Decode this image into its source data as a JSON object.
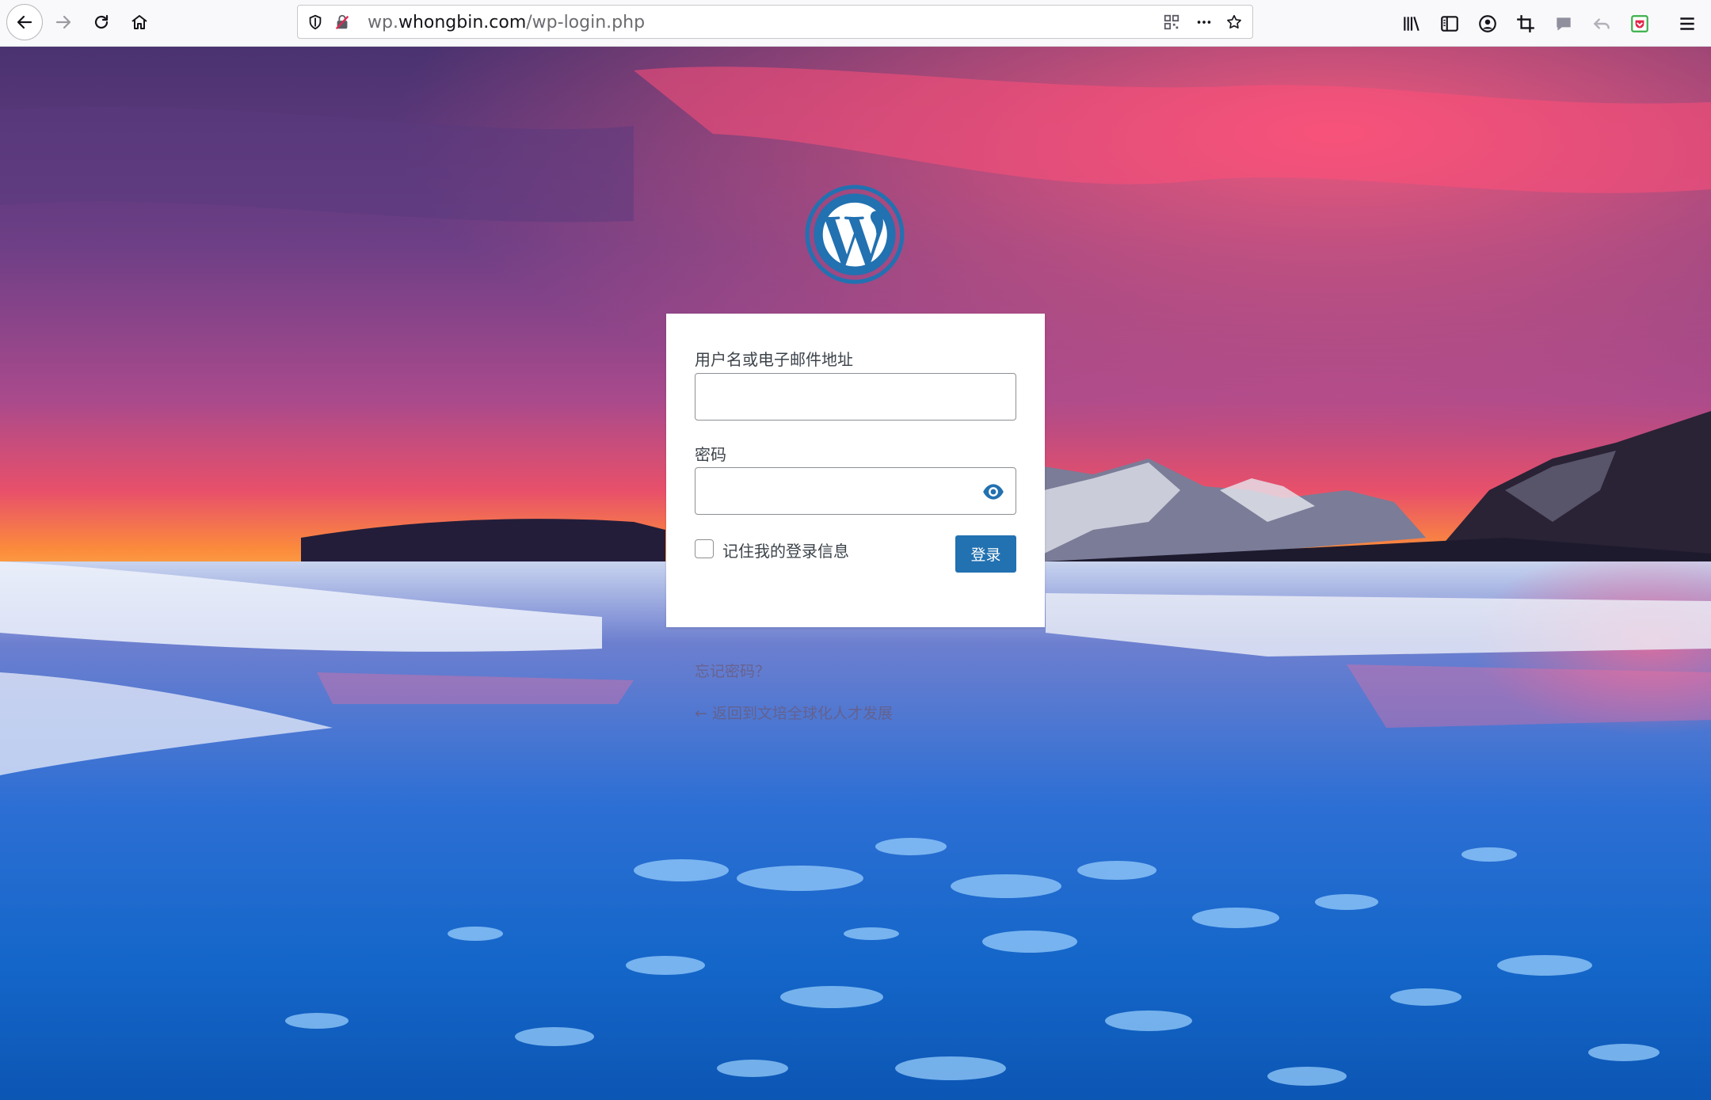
{
  "browser": {
    "url_prefix": "wp.",
    "url_domain": "whongbin.com",
    "url_path": "/wp-login.php",
    "icons": {
      "back": "back-arrow-icon",
      "forward": "forward-arrow-icon",
      "reload": "reload-icon",
      "home": "home-icon",
      "tracking": "shield-icon",
      "insecure": "insecure-lock-icon",
      "qr": "qr-code-icon",
      "page_actions": "more-dots-icon",
      "bookmark": "star-icon",
      "library": "library-icon",
      "sidebar": "sidebar-icon",
      "account": "account-icon",
      "screenshot": "crop-icon",
      "chat": "chat-bubble-icon",
      "undo": "undo-icon",
      "pocket": "pocket-icon",
      "menu": "hamburger-menu-icon"
    }
  },
  "login": {
    "username_label": "用户名或电子邮件地址",
    "username_value": "",
    "password_label": "密码",
    "password_value": "",
    "remember_label": "记住我的登录信息",
    "remember_checked": false,
    "submit_label": "登录",
    "lost_password_link": "忘记密码？",
    "back_link": "← 返回到文培全球化人才发展"
  },
  "colors": {
    "primary_button": "#2271b1",
    "wp_logo": "#2271b1"
  }
}
